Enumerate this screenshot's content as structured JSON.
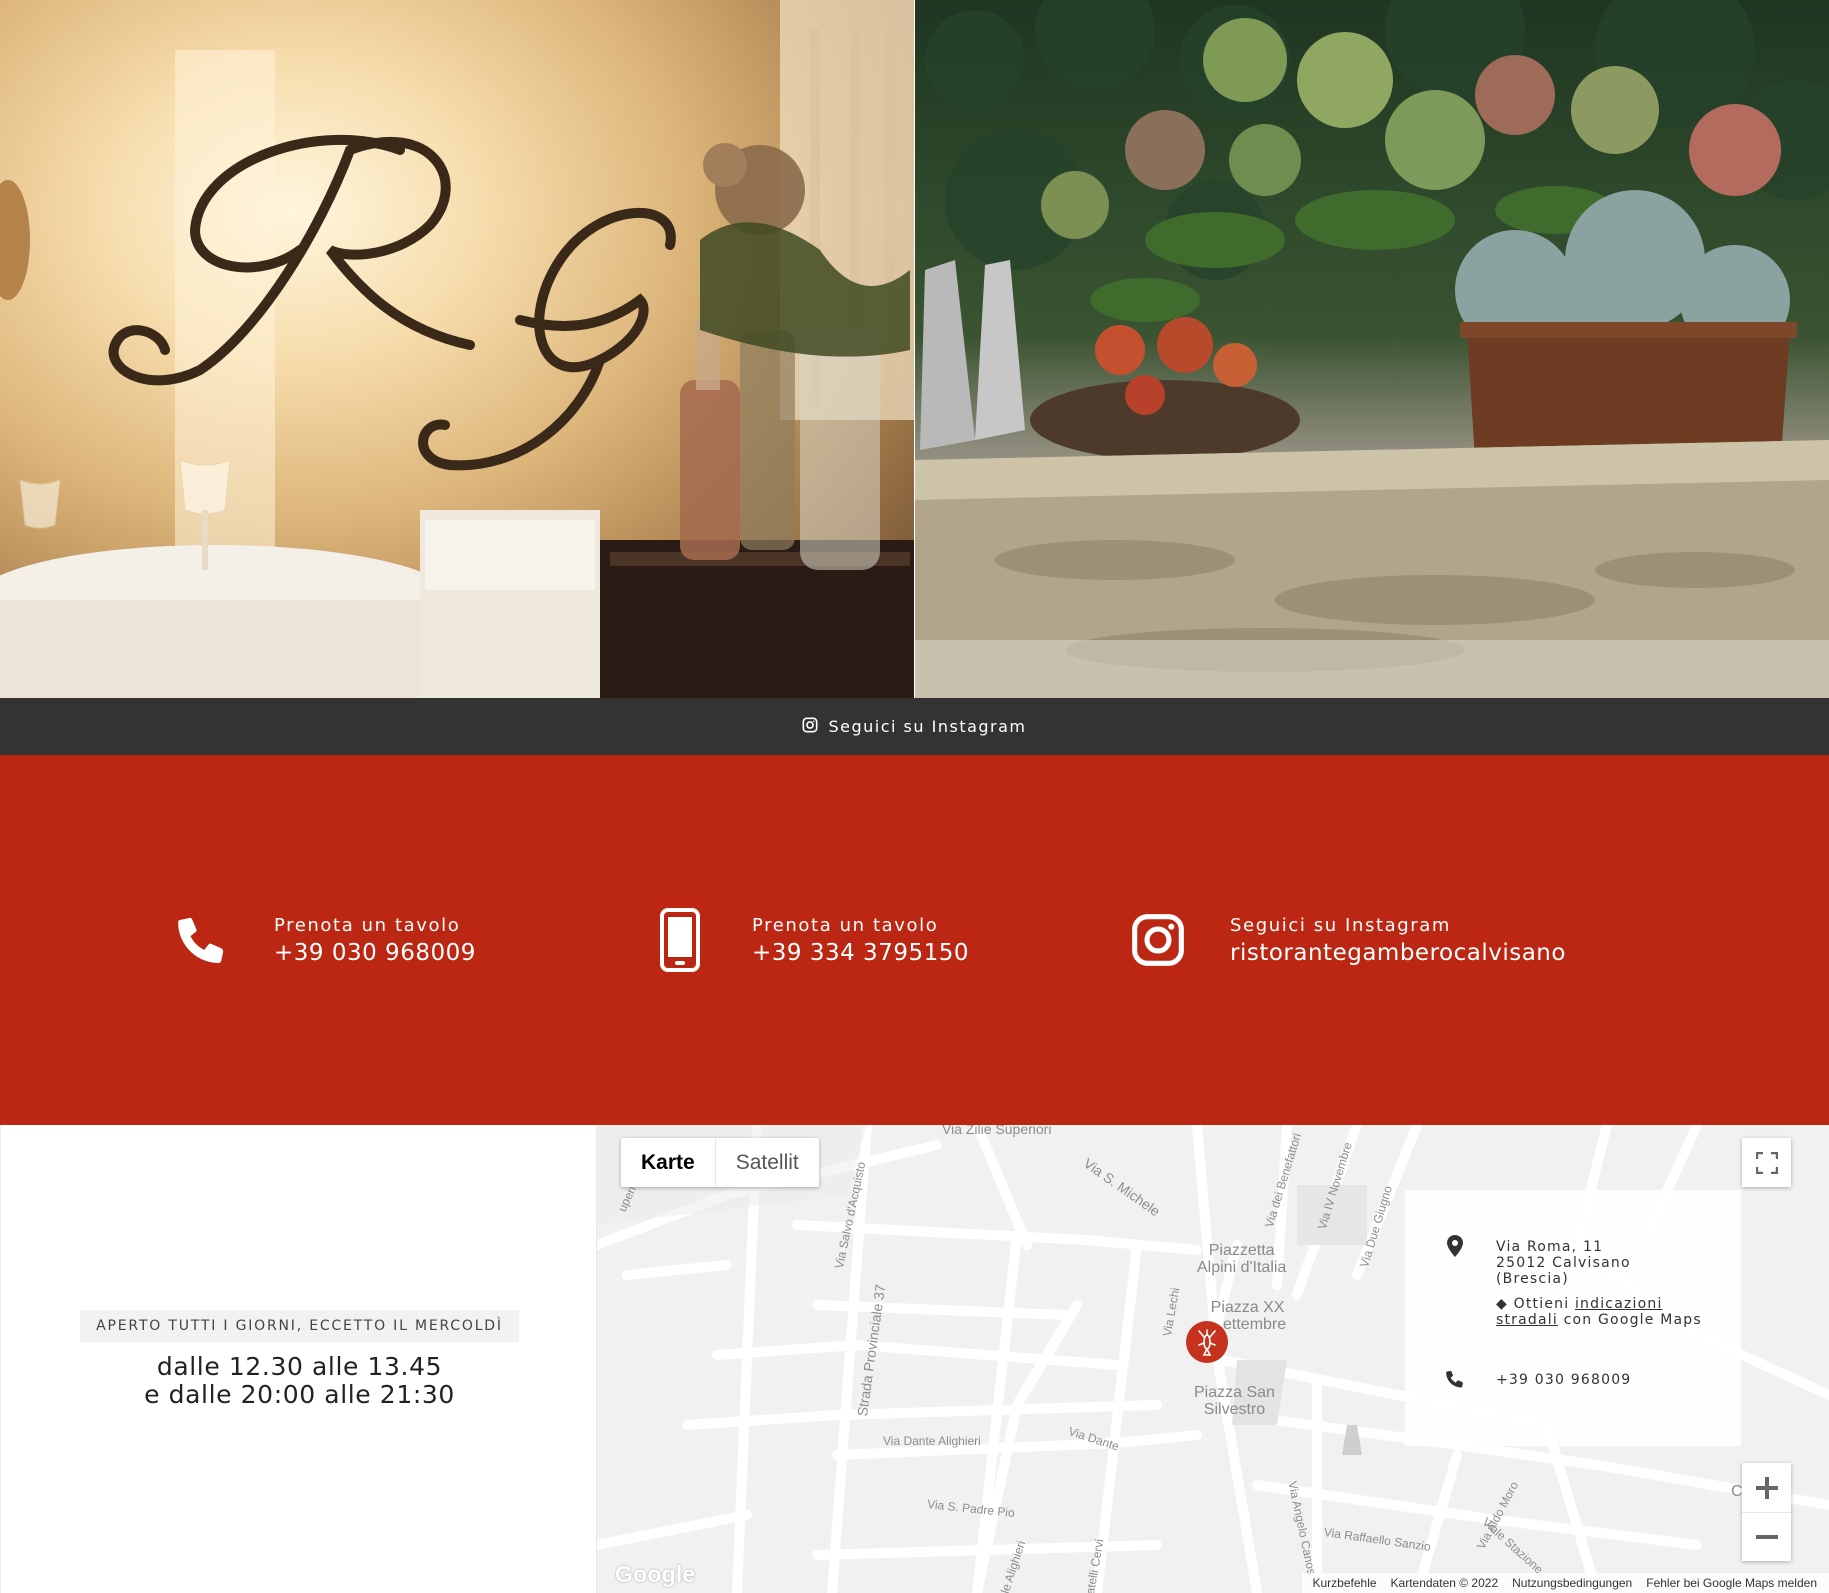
{
  "hero": {
    "left_image": "restaurant dining room with RG logo",
    "right_image": "hydrangea flower pots on stone ledge",
    "logo_text": "RG"
  },
  "instagram_bar": {
    "icon": "instagram-icon",
    "label": "Seguici su Instagram"
  },
  "contact": {
    "background_color": "#bb2713",
    "items": [
      {
        "icon": "phone-icon",
        "label": "Prenota un tavolo",
        "value": "+39 030 968009"
      },
      {
        "icon": "mobile-phone-icon",
        "label": "Prenota un tavolo",
        "value": "+39 334 3795150"
      },
      {
        "icon": "instagram-icon",
        "label": "Seguici su Instagram",
        "value": "ristorantegamberocalvisano"
      }
    ]
  },
  "hours": {
    "badge": "APERTO TUTTI I GIORNI, ECCETTO IL MERCOLDÌ",
    "line1": "dalle 12.30 alle 13.45",
    "line2": "e dalle 20:00 alle 21:30"
  },
  "map": {
    "type_buttons": {
      "map": "Karte",
      "satellite": "Satellit"
    },
    "info": {
      "address_line1": "Via Roma, 11",
      "address_line2": "25012 Calvisano",
      "address_line3": "(Brescia)",
      "directions_prefix": "Ottieni",
      "directions_link": "indicazioni stradali",
      "directions_suffix": "con Google Maps",
      "phone": "+39 030 968009"
    },
    "labels": {
      "via_zilie": "Via Zilie Superiori",
      "via_s_michele": "Via S. Michele",
      "via_benefattori": "Via dei Benefattori",
      "via_iv_novembre": "Via IV Novembre",
      "via_due_giugno": "Via Due Giugno",
      "via_salvo": "Via Salvo d'Acquisto",
      "superiori": "uperiori",
      "piazzetta_line1": "Piazzetta",
      "piazzetta_line2": "Alpini d'Italia",
      "piazza_xx_line1": "Piazza XX",
      "piazza_xx_line2": "ettembre",
      "via_lechi": "Via Lechi",
      "strada_prov": "Strada Provinciale 37",
      "piazza_san_line1": "Piazza San",
      "piazza_san_line2": "Silvestro",
      "via_dante_alighieri": "Via Dante Alighieri",
      "via_dante": "Via Dante",
      "via_padre_pio": "Via S. Padre Pio",
      "via_alighieri": "le Alighieri",
      "via_cervi": "atelli Cervi",
      "via_angelo": "Via Angelo Canos",
      "via_raffaello": "Via Raffaello Sanzio",
      "via_aldo_moro": "Via Aldo Moro",
      "viale_stazione": "Viale Stazione",
      "c_fragment": "C"
    },
    "attribution": {
      "shortcuts": "Kurzbefehle",
      "map_data": "Kartendaten © 2022",
      "terms": "Nutzungsbedingungen",
      "report": "Fehler bei Google Maps melden"
    },
    "google_logo": "Google"
  }
}
